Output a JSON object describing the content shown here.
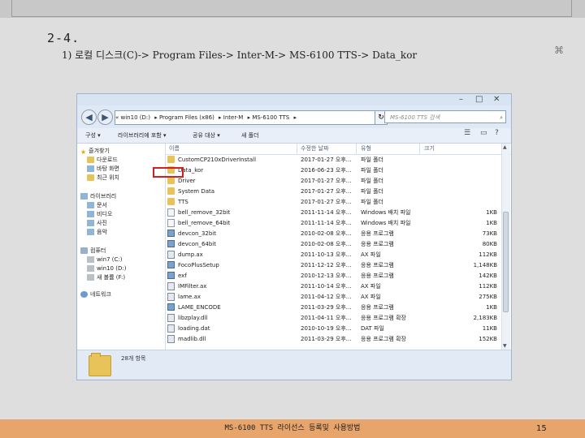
{
  "slide": {
    "section_number": "2-4.",
    "path_instruction": "1) 로컬 디스크(C)-> Program Files-> Inter-M-> MS-6100 TTS-> Data_kor",
    "footer_title": "MS-6100 TTS 라이선스 등록및 사용방법",
    "page_number": "15"
  },
  "explorer": {
    "breadcrumb": [
      "« win10 (D:)",
      "▸ Program Files (x86)",
      "▸ Inter-M",
      "▸ MS-6100 TTS",
      "▸"
    ],
    "search_placeholder": "MS-6100 TTS 검색",
    "toolbar": {
      "organize": "구성 ▾",
      "include_library": "라이브러리에 포함 ▾",
      "share": "공유 대상 ▾",
      "new_folder": "새 폴더"
    },
    "nav": {
      "favorites": "즐겨찾기",
      "downloads": "다운로드",
      "desktop": "바탕 화면",
      "recent": "최근 위치",
      "libraries": "라이브러리",
      "documents": "문서",
      "videos": "비디오",
      "pictures": "사진",
      "music": "음악",
      "computer": "컴퓨터",
      "drive_c": "win7 (C:)",
      "drive_d": "win10 (D:)",
      "new_volume": "새 볼륨 (F:)",
      "network": "네트워크"
    },
    "columns": {
      "name": "이름",
      "date": "수정한 날짜",
      "type": "유형",
      "size": "크기"
    },
    "files": [
      {
        "name": "CustomCP210xDriverInstall",
        "date": "2017-01-27 오후...",
        "type": "파일 폴더",
        "size": "",
        "icon": "folder"
      },
      {
        "name": "Data_kor",
        "date": "2016-06-23 오후...",
        "type": "파일 폴더",
        "size": "",
        "icon": "folder"
      },
      {
        "name": "Driver",
        "date": "2017-01-27 오후...",
        "type": "파일 폴더",
        "size": "",
        "icon": "folder"
      },
      {
        "name": "System Data",
        "date": "2017-01-27 오후...",
        "type": "파일 폴더",
        "size": "",
        "icon": "folder"
      },
      {
        "name": "TTS",
        "date": "2017-01-27 오후...",
        "type": "파일 폴더",
        "size": "",
        "icon": "folder"
      },
      {
        "name": "bell_remove_32bit",
        "date": "2011-11-14 오후...",
        "type": "Windows 배치 파일",
        "size": "1KB",
        "icon": "doc"
      },
      {
        "name": "bell_remove_64bit",
        "date": "2011-11-14 오후...",
        "type": "Windows 배치 파일",
        "size": "1KB",
        "icon": "doc"
      },
      {
        "name": "devcon_32bit",
        "date": "2010-02-08 오후...",
        "type": "응용 프로그램",
        "size": "73KB",
        "icon": "exe"
      },
      {
        "name": "devcon_64bit",
        "date": "2010-02-08 오후...",
        "type": "응용 프로그램",
        "size": "80KB",
        "icon": "exe"
      },
      {
        "name": "dump.ax",
        "date": "2011-10-13 오후...",
        "type": "AX 파일",
        "size": "112KB",
        "icon": "dll"
      },
      {
        "name": "FocoPlusSetup",
        "date": "2011-12-12 오후...",
        "type": "응용 프로그램",
        "size": "1,148KB",
        "icon": "exe"
      },
      {
        "name": "exf",
        "date": "2010-12-13 오후...",
        "type": "응용 프로그램",
        "size": "142KB",
        "icon": "exe"
      },
      {
        "name": "IMFilter.ax",
        "date": "2011-10-14 오후...",
        "type": "AX 파일",
        "size": "112KB",
        "icon": "dll"
      },
      {
        "name": "lame.ax",
        "date": "2011-04-12 오후...",
        "type": "AX 파일",
        "size": "275KB",
        "icon": "dll"
      },
      {
        "name": "LAME_ENCODE",
        "date": "2011-03-29 오후...",
        "type": "응용 프로그램",
        "size": "1KB",
        "icon": "exe"
      },
      {
        "name": "libzplay.dll",
        "date": "2011-04-11 오후...",
        "type": "응용 프로그램 확장",
        "size": "2,183KB",
        "icon": "dll"
      },
      {
        "name": "loading.dat",
        "date": "2010-10-19 오후...",
        "type": "DAT 파일",
        "size": "11KB",
        "icon": "dll"
      },
      {
        "name": "madlib.dll",
        "date": "2011-03-29 오후...",
        "type": "응용 프로그램 확장",
        "size": "152KB",
        "icon": "dll"
      }
    ],
    "status_count": "28개 항목"
  }
}
